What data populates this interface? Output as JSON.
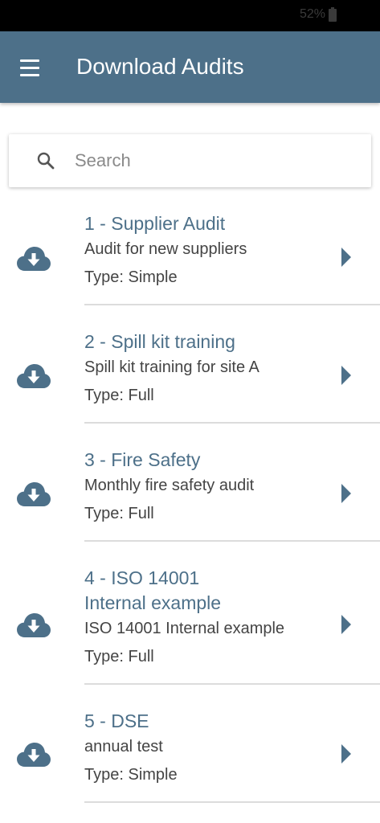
{
  "status_bar": {
    "battery_text": "52%"
  },
  "app_bar": {
    "title": "Download Audits",
    "menu_icon": "hamburger-menu-icon"
  },
  "search": {
    "placeholder": "Search",
    "value": "",
    "icon": "search-icon"
  },
  "colors": {
    "primary": "#4d7089",
    "text": "#444444",
    "divider": "#dcdcdc"
  },
  "audits": [
    {
      "title": "1 - Supplier Audit",
      "description": "Audit for new suppliers",
      "type": "Type: Simple"
    },
    {
      "title": "2 - Spill kit training",
      "description": "Spill kit training for site A",
      "type": "Type: Full"
    },
    {
      "title": "3 - Fire Safety",
      "description": "Monthly fire safety audit",
      "type": "Type: Full"
    },
    {
      "title": "4 - ISO 14001 Internal example",
      "description": "ISO 14001 Internal example",
      "type": "Type: Full"
    },
    {
      "title": "5 - DSE",
      "description": "annual test",
      "type": "Type: Simple"
    }
  ]
}
